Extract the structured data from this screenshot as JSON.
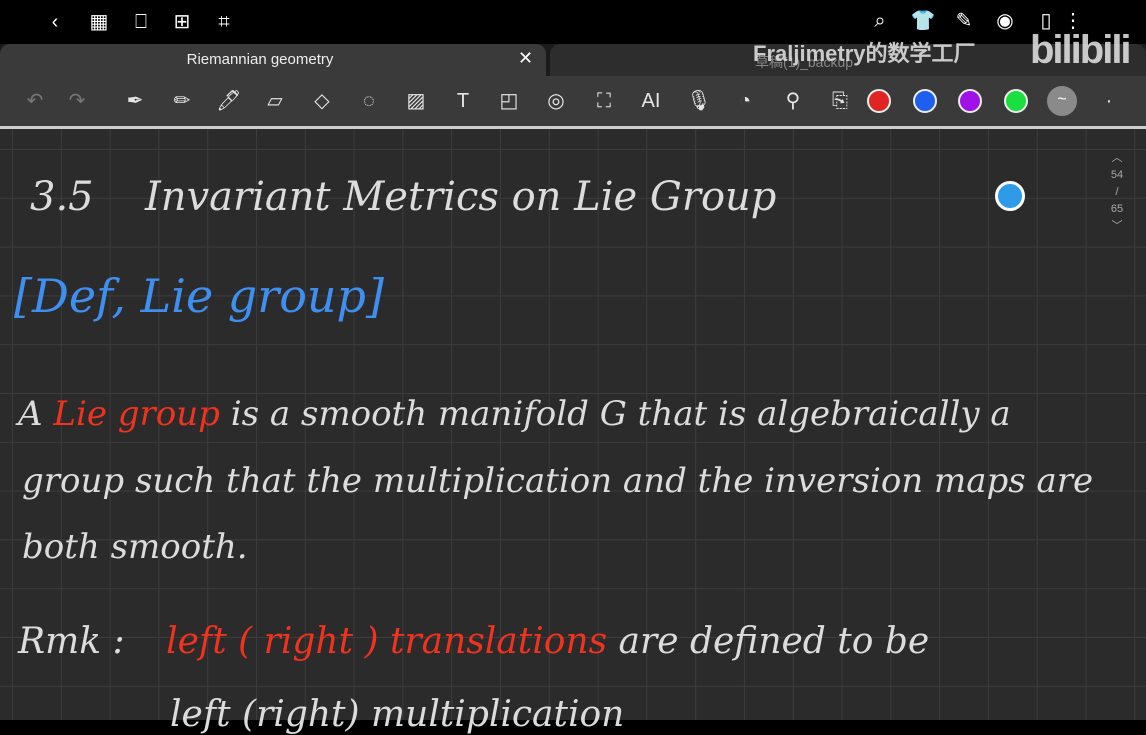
{
  "topbar": {
    "icons": [
      "back-icon",
      "grid-icon",
      "bookmark-icon",
      "add-page-icon",
      "crop-icon",
      "search-icon",
      "theme-icon",
      "pen-edit-icon",
      "eye-icon",
      "notebook-icon",
      "more-icon"
    ]
  },
  "tabs": [
    {
      "label": "Riemannian geometry",
      "close": "✕"
    },
    {
      "label": "草稿(1)_backup"
    }
  ],
  "watermark": {
    "text": "Fraljimetry的数学工厂",
    "logo": "bilibili"
  },
  "toolbar": {
    "ai_label": "AI",
    "colors": [
      "#e02424",
      "#1f5ff0",
      "#a010e8",
      "#19e040",
      "#8a8a8a"
    ]
  },
  "pager": {
    "current": "54",
    "separator": "/",
    "total": "65"
  },
  "note": {
    "heading_num": "3.5",
    "heading": "Invariant Metrics on Lie Group",
    "def": "[Def, Lie group]",
    "p1_a": "A",
    "p1_red": "Lie group",
    "p1_b": "is a smooth manifold G that is algebraically a",
    "p2": "group such that the multiplication and the inversion maps are",
    "p3": "both smooth.",
    "rmk": "Rmk :",
    "rmk_red": "left ( right ) translations",
    "rmk_b": "are defined to be",
    "p5": "left (right) multiplication"
  }
}
